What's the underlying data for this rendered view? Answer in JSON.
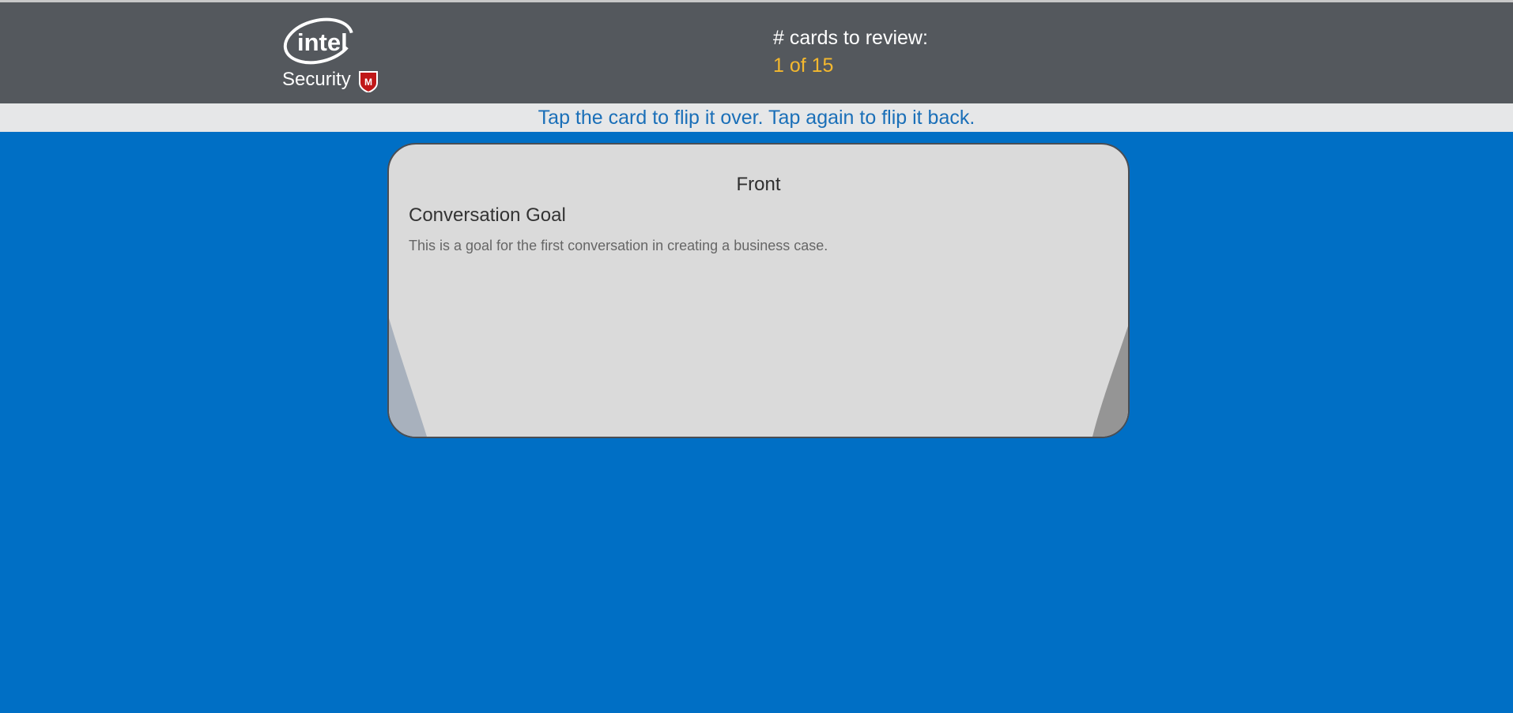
{
  "header": {
    "logo": {
      "icon": "intel-security-logo",
      "wordmark": "intel",
      "subtitle": "Security",
      "badge_letter": "M",
      "badge_color": "#c01818"
    },
    "counter_label": "# cards to review:",
    "counter_value": "1 of 15"
  },
  "instructions": "Tap the card to flip it over. Tap again to flip it back.",
  "card": {
    "side_label": "Front",
    "title": "Conversation Goal",
    "body": "This is a goal for the first conversation in creating a business case."
  },
  "colors": {
    "background": "#006fc5",
    "header_bg": "#54585d",
    "counter_value": "#f4b82e",
    "instruction_text": "#1a6fb8",
    "card_bg": "#dadada"
  }
}
